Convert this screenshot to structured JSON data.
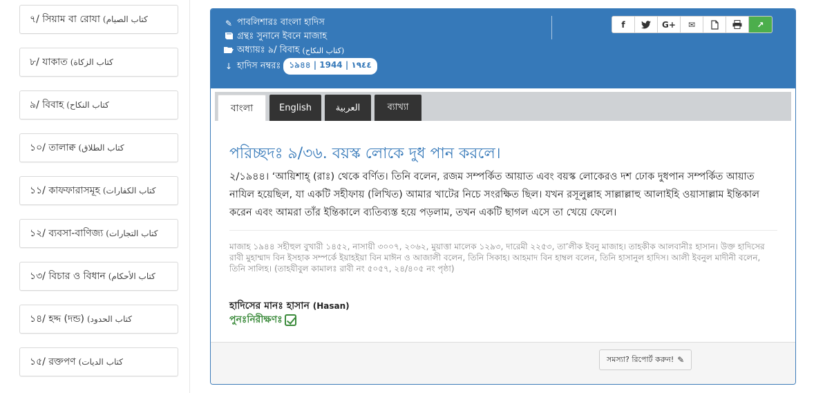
{
  "sidebar": {
    "items": [
      {
        "label": "৭/ সিয়াম বা রোযা",
        "arabic": "(كتاب الصيام"
      },
      {
        "label": "৮/ যাকাত",
        "arabic": "(كتاب الزكاة"
      },
      {
        "label": "৯/ বিবাহ",
        "arabic": "(كتاب النكاح"
      },
      {
        "label": "১০/ তালাক্ব",
        "arabic": "(كتاب الطلاق"
      },
      {
        "label": "১১/ কাফফারাসমূহ",
        "arabic": "(كتاب الكفارات"
      },
      {
        "label": "১২/ ব্যবসা-বাণিজ্য",
        "arabic": "(كتاب التجارات"
      },
      {
        "label": "১৩/ বিচার ও বিধান",
        "arabic": "(كتاب الأحكام"
      },
      {
        "label": "১৪/ হদ্দ (দন্ড)",
        "arabic": "(كتاب الحدود"
      },
      {
        "label": "১৫/ রক্তপণ",
        "arabic": "(كتاب الديات"
      }
    ]
  },
  "header": {
    "publisher": "পাবলিশারঃ বাংলা হাদিস",
    "book": "গ্রন্থঃ সুনানে ইবনে মাজাহ",
    "chapter": "অধ্যায়ঃ ৯/ বিবাহ",
    "chapter_arabic": "(كتاب النكاح)",
    "hadith_number_label": "হাদিস নম্বরঃ",
    "hadith_number": "১৯৪৪ | 1944 | ١٩٤٤"
  },
  "share": {
    "facebook": "f",
    "twitter": "t",
    "google": "G+",
    "email": "✉",
    "pdf": "PDF",
    "print": "⎙",
    "open": "↗"
  },
  "tabs": [
    {
      "label": "বাংলা",
      "active": true
    },
    {
      "label": "English",
      "active": false
    },
    {
      "label": "العربية",
      "active": false
    },
    {
      "label": "ব্যাখ্যা",
      "active": false
    }
  ],
  "content": {
    "section_title": "পরিচ্ছদঃ ৯/৩৬. বয়স্ক লোকে দুধ পান করলে।",
    "hadith_text": "২/১৯৪৪। ‘আয়িশাহ্ (রাঃ) থেকে বর্ণিত। তিনি বলেন, রজম সম্পর্কিত আয়াত এবং বয়স্ক লোকেরও দশ ঢোক দুধপান সম্পর্কিত আয়াত নাযিল হয়েছিল, যা একটি সহীফায় (লিখিত) আমার খাটের নিচে সংরক্ষিত ছিল। যখন রসূলুল্লাহ সাল্লাল্লাহু আলাইহি ওয়াসাল্লাম ইন্তিকাল করেন এবং আমরা তাঁর ইন্তিকালে ব্যতিব্যস্ত হয়ে পড়লাম, তখন একটি ছাগল এসে তা খেয়ে ফেলে।",
    "reference": "মাজাহ ১৯৪৪ সহীহুল বুখারী ১৪৫২, নাসায়ী ৩০০৭, ২০৬২, মুয়াত্তা মালেক ১২৯৩, দারেমী ২২৫৩, তা’লীক ইবনু মাজাহ। তাহকীক আলবানীঃ হাসান। উক্ত হাদিসের রাবী মুহাম্মাদ বিন ইসহাক সম্পর্কে ইয়াহইয়া বিন মাঈন ও আজালী বলেন, তিনি সিকাহ। আহমাদ বিন হাম্বল বলেন, তিনি হাসানুল হাদিস। আলী ইবনুল মাদীনী বলেন, তিনি সালিহ। (তাহযীবুল কামালঃ রাবী নং ৫০৫৭, ২৪/৪০৫ নং পৃষ্ঠা)",
    "grade_label": "হাদিসের মানঃ হাসান",
    "grade_en": "(Hasan)",
    "review_label": "পুনঃনিরীক্ষণঃ"
  },
  "footer": {
    "report_label": "সমস্যা? রিপোর্ট করুন!"
  },
  "colors": {
    "header_blue": "#3679b9",
    "title_blue": "#3679b9",
    "review_green": "#3a8a3a",
    "open_button_green": "#4cae4c"
  }
}
